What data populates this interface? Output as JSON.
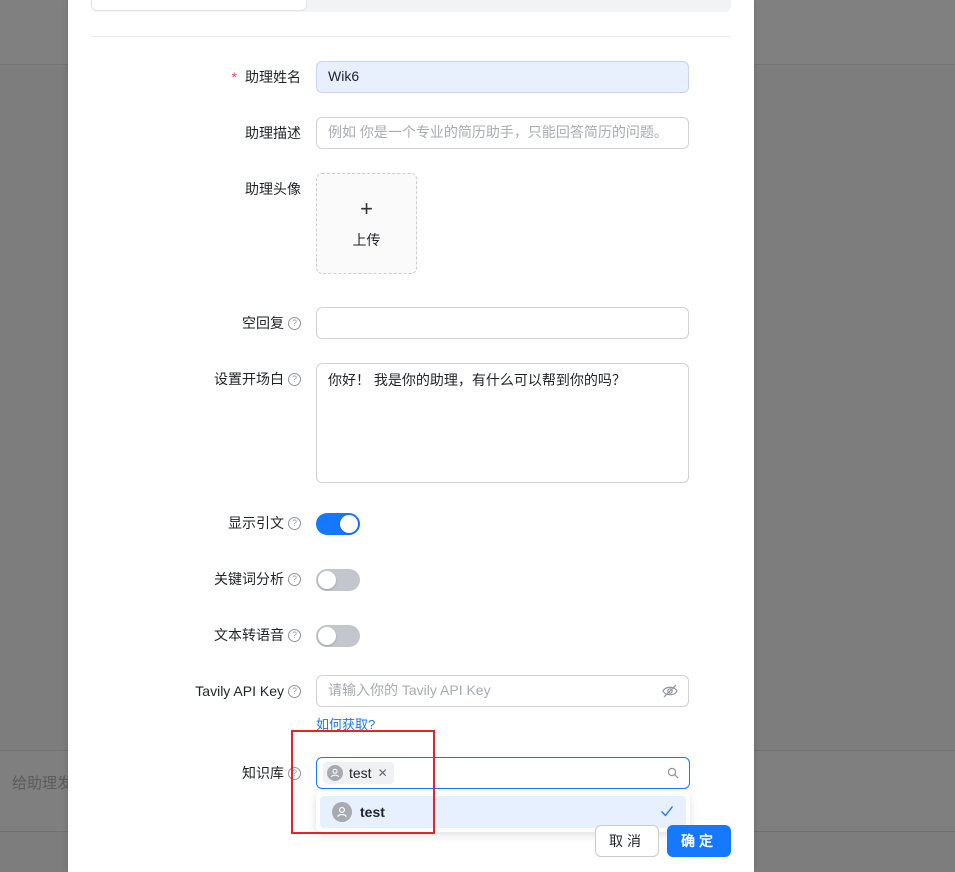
{
  "background": {
    "input_placeholder": "给助理发"
  },
  "form": {
    "name": {
      "label": "助理姓名",
      "required_mark": "*",
      "value": "Wik6"
    },
    "description": {
      "label": "助理描述",
      "placeholder": "例如 你是一个专业的简历助手，只能回答简历的问题。"
    },
    "avatar": {
      "label": "助理头像",
      "upload_icon": "plus-icon",
      "upload_label": "上传"
    },
    "empty_reply": {
      "label": "空回复",
      "value": ""
    },
    "opening": {
      "label": "设置开场白",
      "value": "你好！ 我是你的助理，有什么可以帮到你的吗？"
    },
    "show_citation": {
      "label": "显示引文",
      "enabled": true
    },
    "keyword_analysis": {
      "label": "关键词分析",
      "enabled": false
    },
    "tts": {
      "label": "文本转语音",
      "enabled": false
    },
    "tavily": {
      "label": "Tavily API Key",
      "placeholder": "请输入你的 Tavily API Key",
      "link": "如何获取?"
    },
    "knowledge_base": {
      "label": "知识库",
      "selected": [
        "test"
      ],
      "options": [
        {
          "label": "test",
          "selected": true
        }
      ]
    }
  },
  "help_icon": "?",
  "footer": {
    "cancel": "取消",
    "ok": "确定"
  },
  "colors": {
    "primary": "#1677ff",
    "required": "#f54a45",
    "highlight": "#e0262b"
  }
}
